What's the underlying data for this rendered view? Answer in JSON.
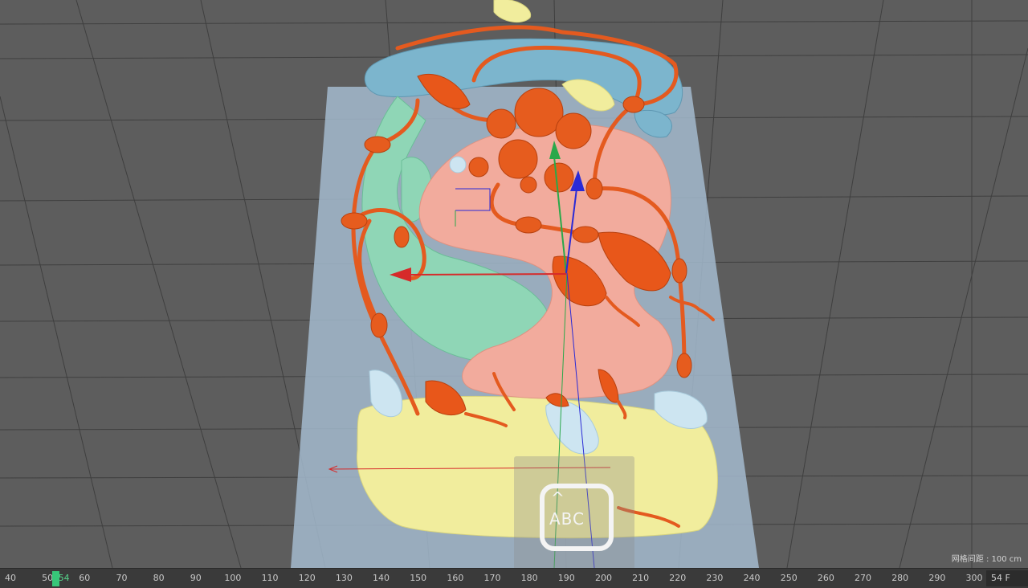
{
  "viewport": {
    "grid_spacing_label": "网格间距 : 100 cm",
    "overlay_icon": {
      "name": "text-abc-icon",
      "caret": "^",
      "label": "ABC"
    },
    "colors": {
      "background": "#5e5e5e",
      "ground_plane": "#9fb6cc",
      "orange": "#e85a1e",
      "blue": "#7fb7cf",
      "green": "#8fd8b8",
      "pink": "#f2aa9c",
      "yellow": "#f2ee9e",
      "light_blue": "#cfe6f1",
      "axis_x": "#d62a2a",
      "axis_y": "#2aa84a",
      "axis_z": "#2a2ad6"
    }
  },
  "timeline": {
    "tick_labels": [
      "40",
      "50",
      "54",
      "60",
      "70",
      "80",
      "90",
      "100",
      "110",
      "120",
      "130",
      "140",
      "150",
      "160",
      "170",
      "180",
      "190",
      "200",
      "210",
      "220",
      "230",
      "240",
      "250",
      "260",
      "270",
      "280",
      "290",
      "300"
    ],
    "current_frame": "54",
    "frame_display": "54 F"
  }
}
